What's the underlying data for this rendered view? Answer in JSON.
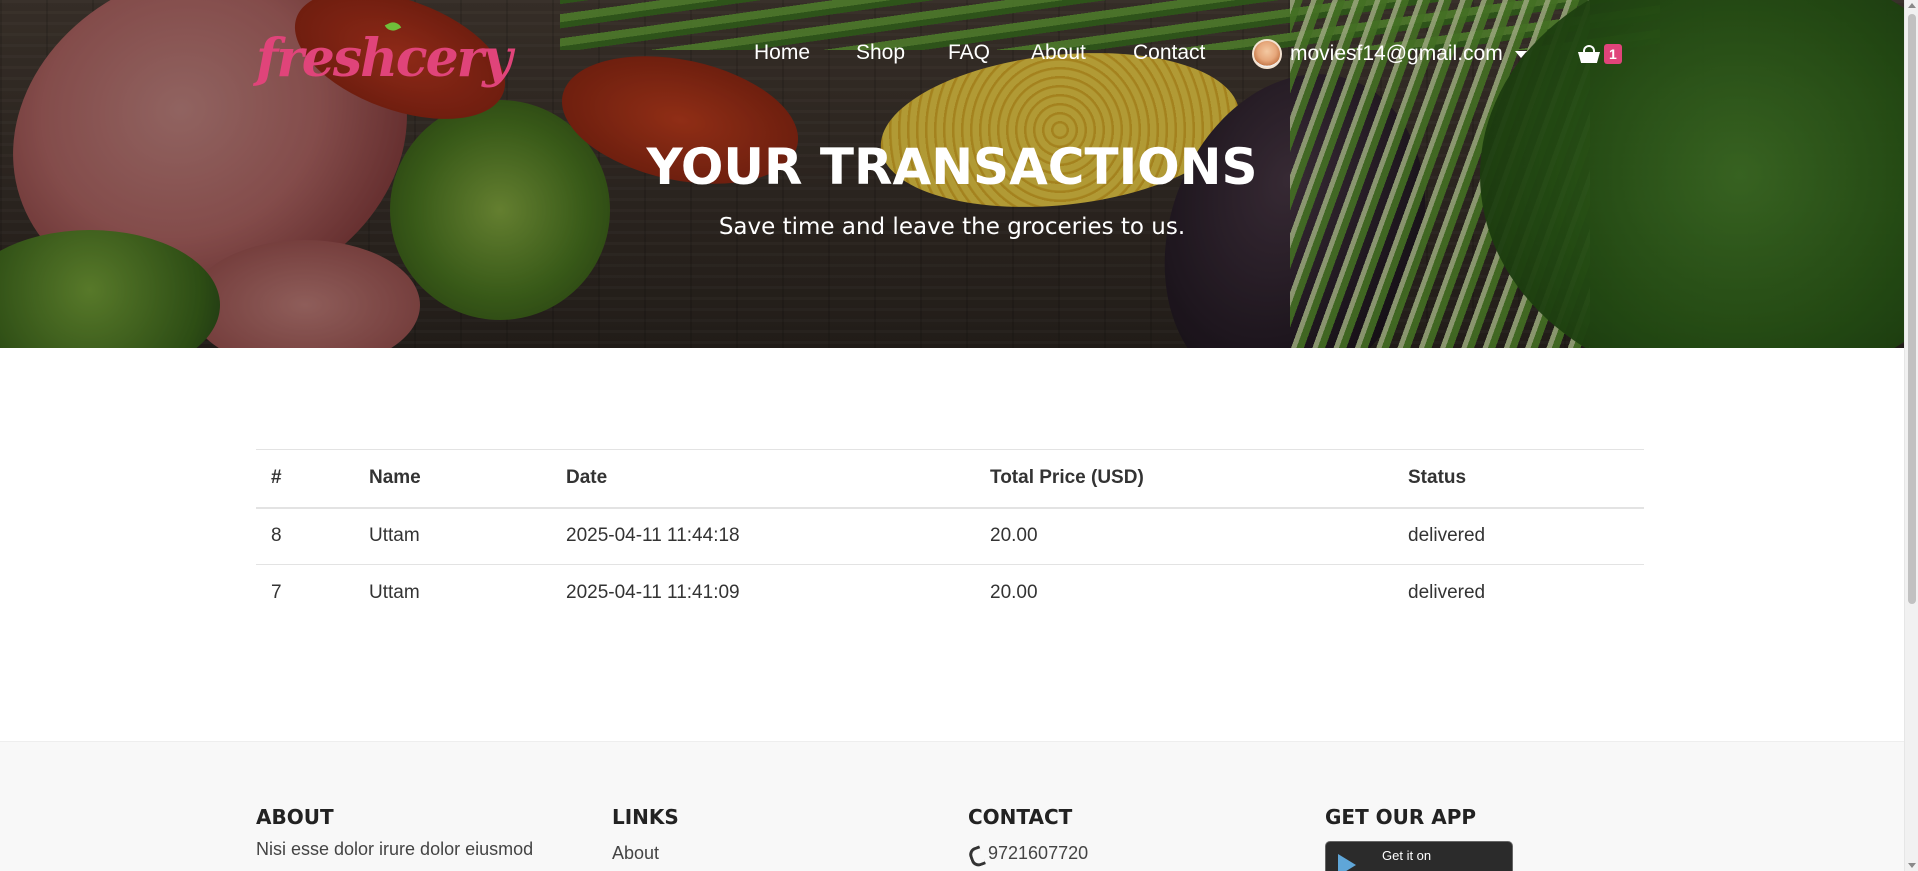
{
  "brand": {
    "logo_text": "freshcery",
    "accent_color": "#e0447a"
  },
  "nav": {
    "items": [
      {
        "label": "Home"
      },
      {
        "label": "Shop"
      },
      {
        "label": "FAQ"
      },
      {
        "label": "About"
      },
      {
        "label": "Contact"
      }
    ],
    "user_email": "moviesf14@gmail.com",
    "cart_count": "1"
  },
  "hero": {
    "title": "YOUR TRANSACTIONS",
    "subtitle": "Save time and leave the groceries to us."
  },
  "transactions": {
    "columns": [
      "#",
      "Name",
      "Date",
      "Total Price (USD)",
      "Status"
    ],
    "rows": [
      {
        "id": "8",
        "name": "Uttam",
        "date": "2025-04-11 11:44:18",
        "total": "20.00",
        "status": "delivered"
      },
      {
        "id": "7",
        "name": "Uttam",
        "date": "2025-04-11 11:41:09",
        "total": "20.00",
        "status": "delivered"
      }
    ]
  },
  "footer": {
    "about": {
      "heading": "ABOUT",
      "text": "Nisi esse dolor irure dolor eiusmod"
    },
    "links": {
      "heading": "LINKS",
      "first_link": "About"
    },
    "contact": {
      "heading": "CONTACT",
      "phone": "9721607720"
    },
    "app": {
      "heading": "GET OUR APP",
      "store_text": "Get it on"
    }
  }
}
